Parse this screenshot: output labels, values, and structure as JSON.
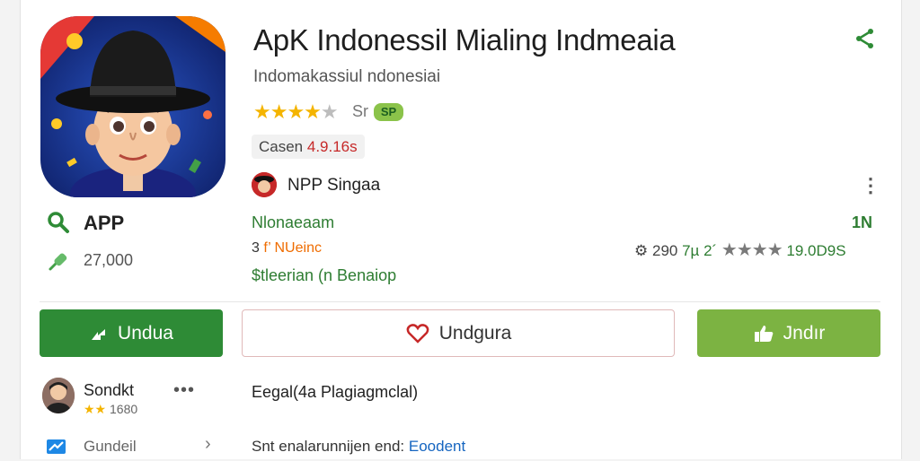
{
  "app": {
    "title": "ApK Indonessil Mialing Indmeaia",
    "subtitle": "Indomakassiul ndonesiai",
    "stars_suffix": "Sr",
    "badge": "SP",
    "version_label": "Casen",
    "version_value": "4.9.16s",
    "developer": "NPP Singaa"
  },
  "stats": {
    "app_label": "APP",
    "count": "27,000",
    "line1": "Nlonaeaam",
    "line2_prefix": "3",
    "line2_highlight": "f’ NUeinc",
    "line3": "$tleerian (n Benaiop",
    "right_top": "1N",
    "right_row_a": "290",
    "right_row_b": "7µ 2´",
    "right_row_stars": "★★★★",
    "right_row_value": "19.0D9S"
  },
  "buttons": {
    "primary": "Undua",
    "secondary": "Undgura",
    "tertiary": "Jndır"
  },
  "review": {
    "user": "Sondkt",
    "dots": "•••",
    "rating": "1680",
    "legal": "Eegal(4a Plagiagmclal)"
  },
  "footer": {
    "label": "Gundeil",
    "text_prefix": "Snt enalarunnijen end:",
    "text_link": "Eoodent"
  },
  "colors": {
    "primary_green": "#2e8b36",
    "light_green": "#7cb342",
    "star": "#f4b400",
    "accent_red": "#c62828"
  },
  "icons": [
    "share-icon",
    "search-icon",
    "pin-icon",
    "kebab-icon",
    "arrow-icon",
    "heart-icon",
    "thumbs-up-icon",
    "gear-icon",
    "chevron-right-icon",
    "mail-icon"
  ]
}
